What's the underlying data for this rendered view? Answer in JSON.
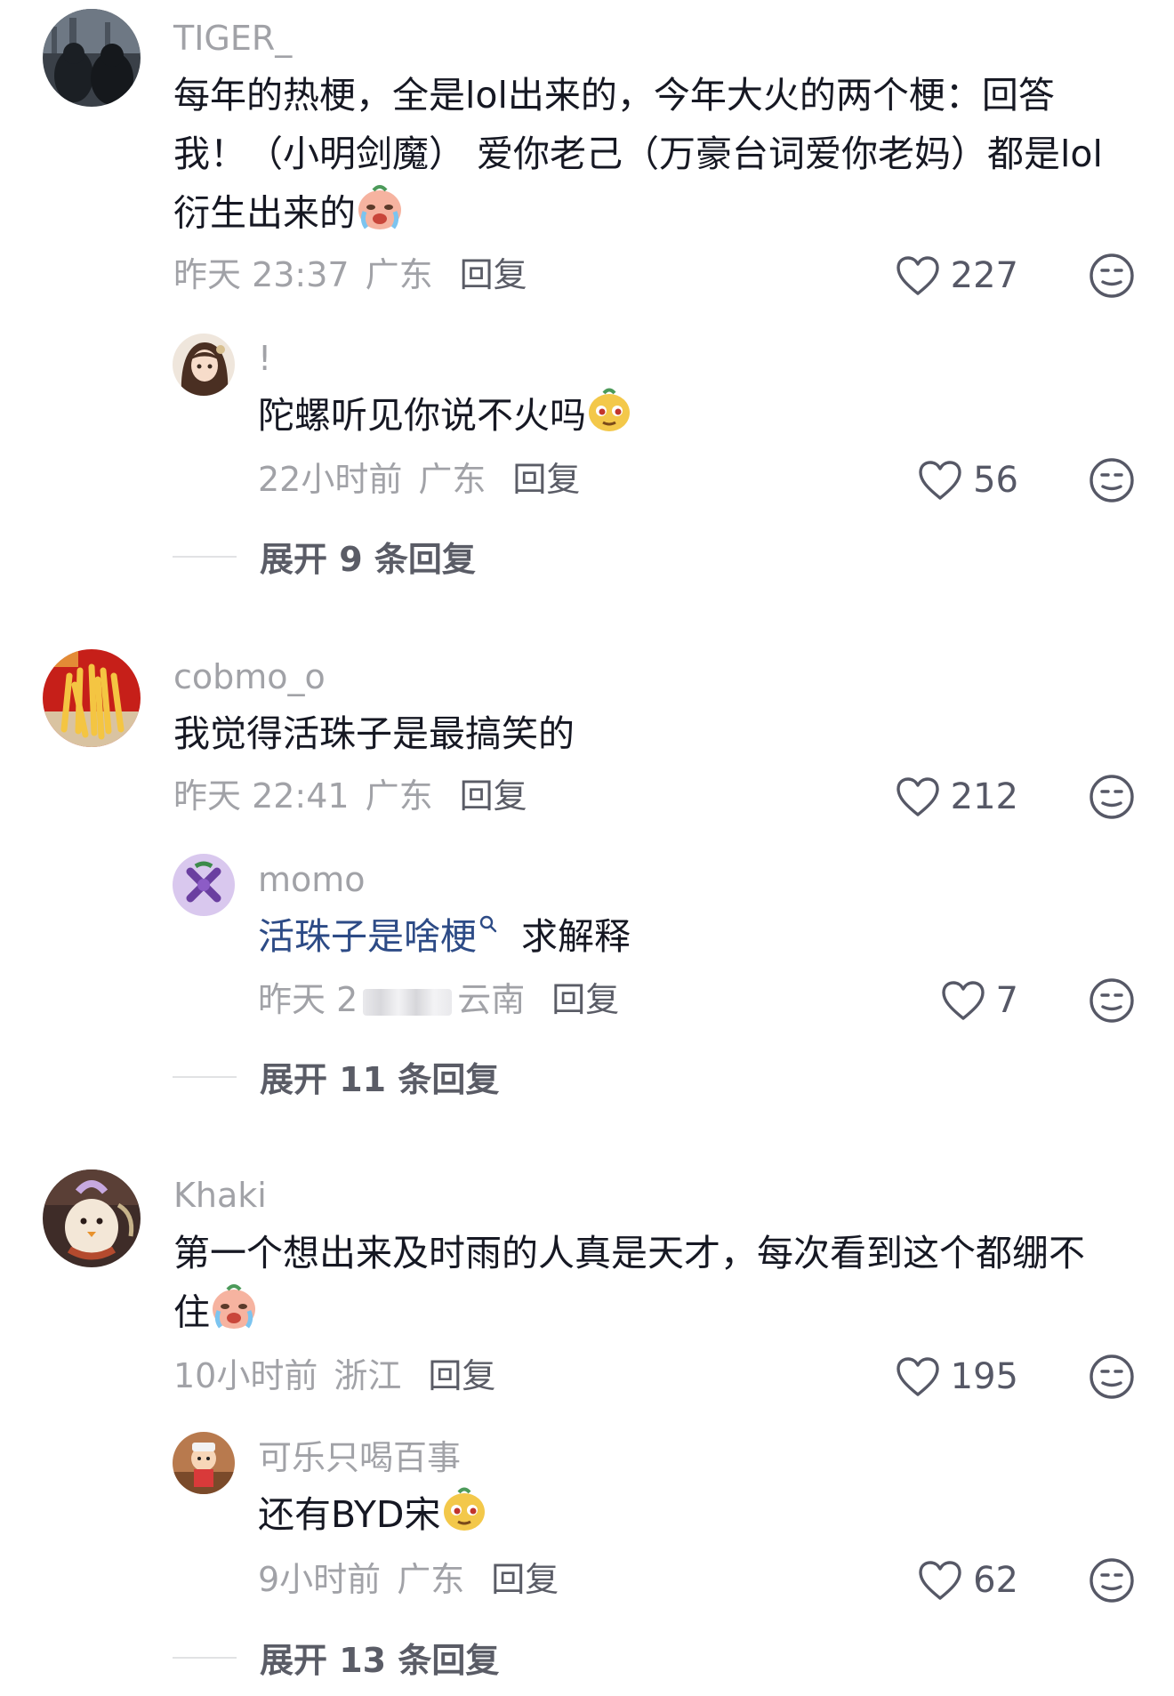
{
  "comments": [
    {
      "user": "TIGER_",
      "text_line1": "每年的热梗，全是lol出来的，今年大火的两个梗：回答",
      "text_line2": "我！（小明剑魔） 爱你老己（万豪台词爱你老妈）都是lol",
      "text_line3": "衍生出来的",
      "time": "昨天 23:37",
      "region": "广东",
      "reply_label": "回复",
      "likes": "227",
      "replies": [
        {
          "user": "!",
          "text": "陀螺听见你说不火吗",
          "time": "22小时前",
          "region": "广东",
          "reply_label": "回复",
          "likes": "56"
        }
      ],
      "expand_label": "展开 9 条回复"
    },
    {
      "user": "cobmo_o",
      "text_line1": "我觉得活珠子是最搞笑的",
      "time": "昨天 22:41",
      "region": "广东",
      "reply_label": "回复",
      "likes": "212",
      "replies": [
        {
          "user": "momo",
          "text_link": "活珠子是啥梗",
          "text_rest": "求解释",
          "time_prefix": "昨天 2",
          "region": "云南",
          "reply_label": "回复",
          "likes": "7"
        }
      ],
      "expand_label": "展开 11 条回复"
    },
    {
      "user": "Khaki",
      "text_line1": "第一个想出来及时雨的人真是天才，每次看到这个都绷不",
      "text_line2": "住",
      "time": "10小时前",
      "region": "浙江",
      "reply_label": "回复",
      "likes": "195",
      "replies": [
        {
          "user": "可乐只喝百事",
          "text": "还有BYD宋",
          "time": "9小时前",
          "region": "广东",
          "reply_label": "回复",
          "likes": "62"
        }
      ],
      "expand_label": "展开 13 条回复"
    }
  ]
}
